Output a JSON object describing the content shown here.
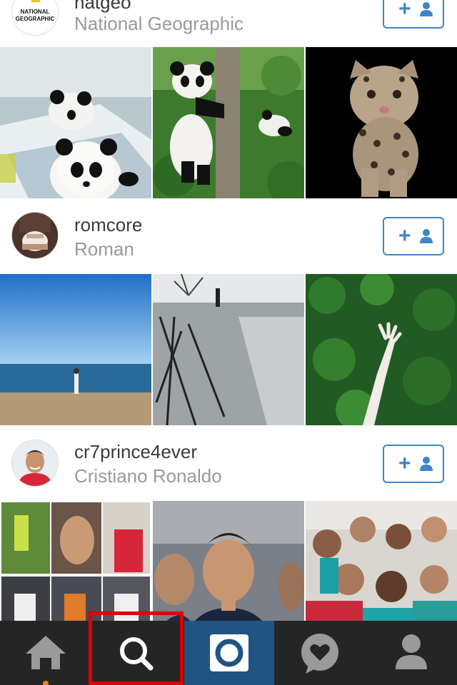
{
  "users": [
    {
      "username": "natgeo",
      "full_name": "National Geographic",
      "avatar_text_line1": "NATIONAL",
      "avatar_text_line2": "GEOGRAPHIC",
      "follow_icon": "add-user-icon"
    },
    {
      "username": "romcore",
      "full_name": "Roman",
      "follow_icon": "add-user-icon"
    },
    {
      "username": "cr7prince4ever",
      "full_name": "Cristiano Ronaldo",
      "follow_icon": "add-user-icon"
    }
  ],
  "follow_symbol": "+",
  "tab_bar": {
    "tabs": [
      "home-icon",
      "search-icon",
      "camera-icon",
      "activity-heart-icon",
      "profile-icon"
    ],
    "selected": "search-icon"
  },
  "colors": {
    "accent": "#3f85c5",
    "tab_bar": "#252526",
    "camera_tab": "#215482",
    "highlight_box": "#e00000",
    "home_dot": "#f58220"
  }
}
